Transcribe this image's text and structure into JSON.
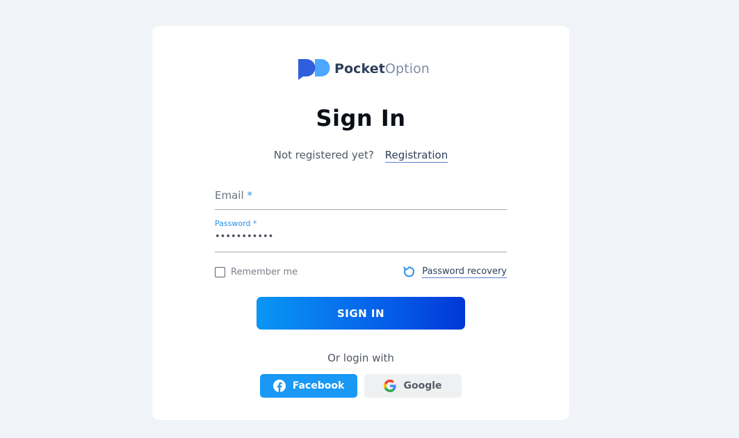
{
  "brand": {
    "name_bold": "Pocket",
    "name_light": "Option",
    "colors": {
      "primary": "#0457e6",
      "accent": "#2b8fe8",
      "logo_dark": "#2f5fdc",
      "logo_light": "#4da6ff"
    }
  },
  "form": {
    "title": "Sign In",
    "not_registered": "Not registered yet?",
    "registration_link": "Registration",
    "email": {
      "label": "Email",
      "required_mark": "*",
      "value": ""
    },
    "password": {
      "label": "Password",
      "required_mark": "*",
      "value": "•••••••••••"
    },
    "remember_me": {
      "label": "Remember me",
      "checked": false
    },
    "password_recovery": "Password recovery",
    "submit_label": "SIGN IN"
  },
  "social": {
    "heading": "Or login with",
    "facebook_label": "Facebook",
    "google_label": "Google",
    "facebook_icon": "facebook-icon",
    "google_icon": "google-icon"
  }
}
